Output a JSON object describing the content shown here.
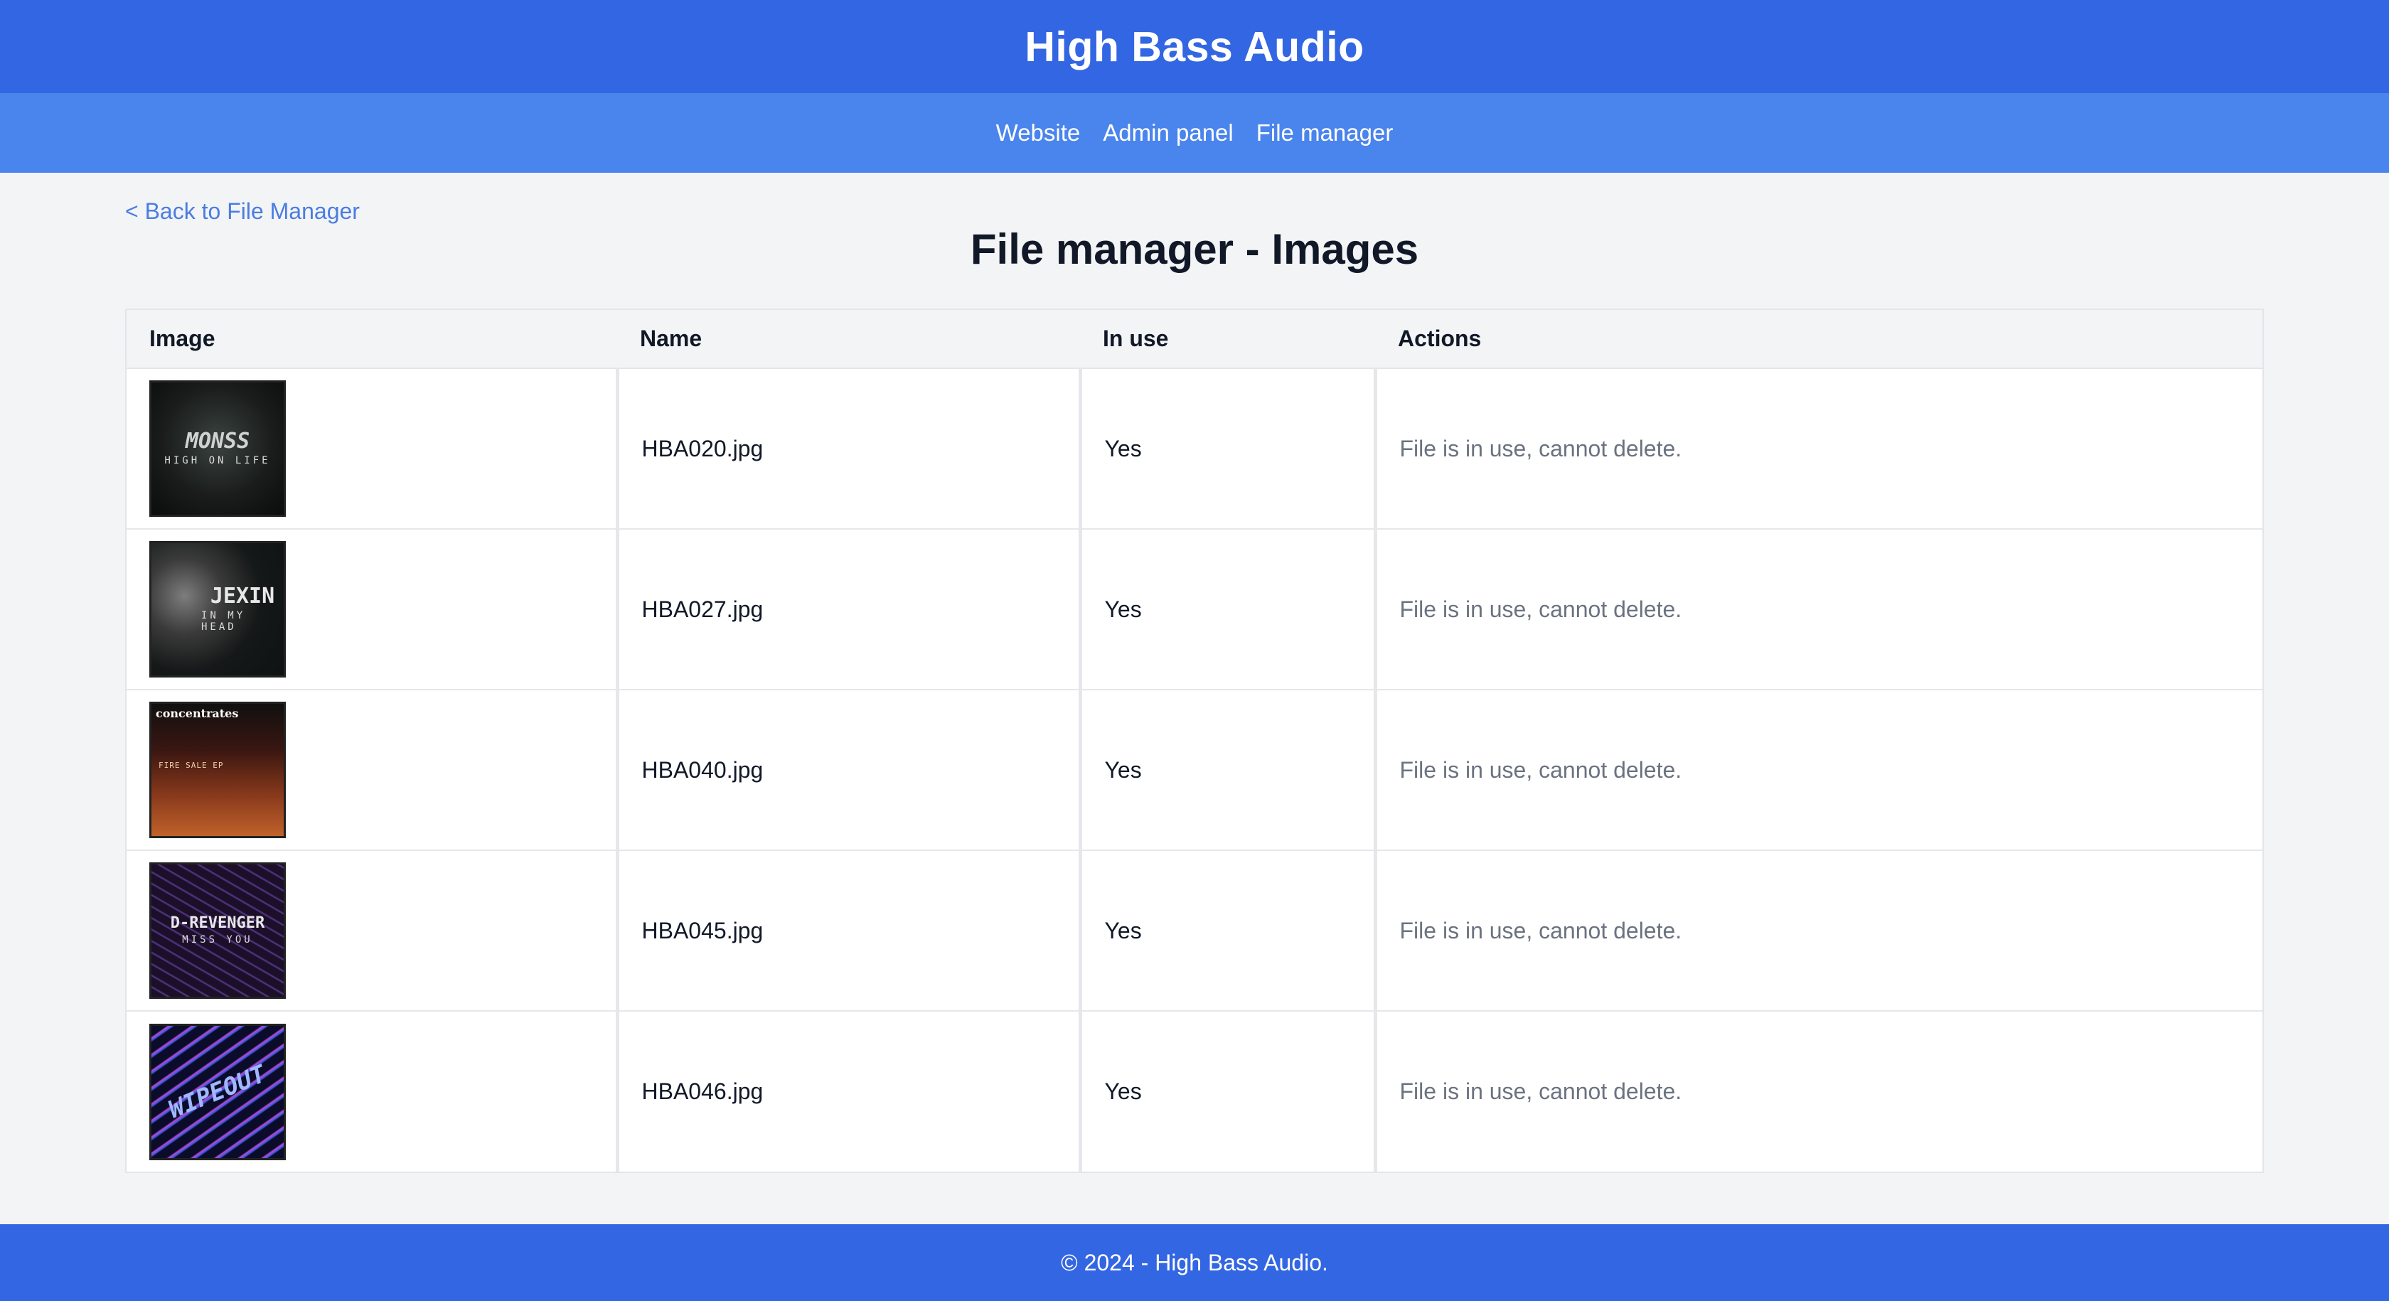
{
  "header": {
    "title": "High Bass Audio"
  },
  "nav": {
    "items": [
      {
        "label": "Website"
      },
      {
        "label": "Admin panel"
      },
      {
        "label": "File manager"
      }
    ]
  },
  "main": {
    "back_link": "< Back to File Manager",
    "page_title": "File manager - Images",
    "table": {
      "headers": [
        "Image",
        "Name",
        "In use",
        "Actions"
      ],
      "rows": [
        {
          "thumb_title": "MONSS",
          "thumb_sub": "HIGH ON LIFE",
          "name": "HBA020.jpg",
          "in_use": "Yes",
          "action": "File is in use, cannot delete."
        },
        {
          "thumb_title": "JEXIN",
          "thumb_sub": "IN MY HEAD",
          "name": "HBA027.jpg",
          "in_use": "Yes",
          "action": "File is in use, cannot delete."
        },
        {
          "thumb_title": "concentrates",
          "thumb_sub": "FIRE SALE EP",
          "name": "HBA040.jpg",
          "in_use": "Yes",
          "action": "File is in use, cannot delete."
        },
        {
          "thumb_title": "D-REVENGER",
          "thumb_sub": "MISS YOU",
          "name": "HBA045.jpg",
          "in_use": "Yes",
          "action": "File is in use, cannot delete."
        },
        {
          "thumb_title": "WIPEOUT",
          "thumb_sub": "",
          "name": "HBA046.jpg",
          "in_use": "Yes",
          "action": "File is in use, cannot delete."
        }
      ]
    }
  },
  "footer": {
    "text": "© 2024 - High Bass Audio."
  },
  "colors": {
    "header_bg": "#3366e2",
    "nav_bg": "#4a84ed",
    "link": "#4a7de0",
    "muted": "#6b7280"
  }
}
